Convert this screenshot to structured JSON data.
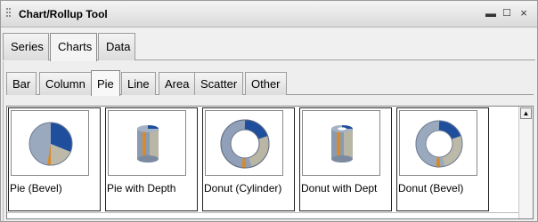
{
  "window": {
    "title": "Chart/Rollup Tool"
  },
  "controls": {
    "minimize": "▬",
    "maximize": "☐",
    "close": "×"
  },
  "top_tabs": [
    {
      "label": "Series"
    },
    {
      "label": "Charts",
      "active": true
    },
    {
      "label": "Data"
    }
  ],
  "chart_tabs": [
    {
      "label": "Bar"
    },
    {
      "label": "Column"
    },
    {
      "label": "Pie",
      "active": true
    },
    {
      "label": "Line"
    },
    {
      "label": "Area"
    },
    {
      "label": "Scatter"
    },
    {
      "label": "Other"
    }
  ],
  "chart_styles": [
    {
      "label": "Pie (Bevel)",
      "icon": "pie-bevel-icon"
    },
    {
      "label": "Pie with Depth",
      "icon": "pie-depth-icon"
    },
    {
      "label": "Donut (Cylinder)",
      "icon": "donut-cylinder-icon"
    },
    {
      "label": "Donut with Dept",
      "icon": "donut-depth-icon"
    },
    {
      "label": "Donut (Bevel)",
      "icon": "donut-bevel-icon"
    }
  ],
  "colors": {
    "slice_blue": "#1f4e9c",
    "slice_grey": "#8fa0b8",
    "slice_light": "#b9b6a6",
    "slice_orange": "#d88a2a"
  },
  "scrollbar": {
    "up_arrow": "▲"
  }
}
